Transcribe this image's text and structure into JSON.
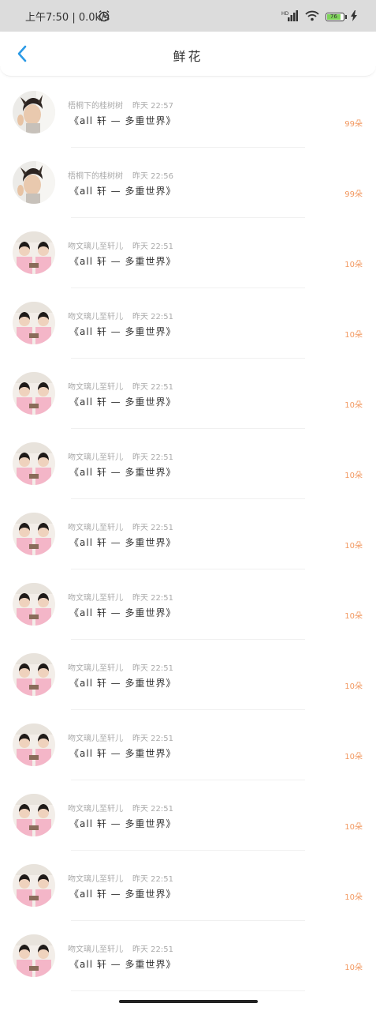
{
  "status_bar": {
    "time_speed": "上午7:50 | 0.0k/s",
    "signal_label": "HD",
    "battery_level": "76"
  },
  "header": {
    "title": "鲜花"
  },
  "items": [
    {
      "user": "梧桐下的桂树树",
      "time": "昨天 22:57",
      "book": "《all 轩 — 多重世界》",
      "count": "99朵",
      "avatar": "person-a"
    },
    {
      "user": "梧桐下的桂树树",
      "time": "昨天 22:56",
      "book": "《all 轩 — 多重世界》",
      "count": "99朵",
      "avatar": "person-a"
    },
    {
      "user": "吻文璃儿至轩儿",
      "time": "昨天 22:51",
      "book": "《all 轩 — 多重世界》",
      "count": "10朵",
      "avatar": "person-b"
    },
    {
      "user": "吻文璃儿至轩儿",
      "time": "昨天 22:51",
      "book": "《all 轩 — 多重世界》",
      "count": "10朵",
      "avatar": "person-b"
    },
    {
      "user": "吻文璃儿至轩儿",
      "time": "昨天 22:51",
      "book": "《all 轩 — 多重世界》",
      "count": "10朵",
      "avatar": "person-b"
    },
    {
      "user": "吻文璃儿至轩儿",
      "time": "昨天 22:51",
      "book": "《all 轩 — 多重世界》",
      "count": "10朵",
      "avatar": "person-b"
    },
    {
      "user": "吻文璃儿至轩儿",
      "time": "昨天 22:51",
      "book": "《all 轩 — 多重世界》",
      "count": "10朵",
      "avatar": "person-b"
    },
    {
      "user": "吻文璃儿至轩儿",
      "time": "昨天 22:51",
      "book": "《all 轩 — 多重世界》",
      "count": "10朵",
      "avatar": "person-b"
    },
    {
      "user": "吻文璃儿至轩儿",
      "time": "昨天 22:51",
      "book": "《all 轩 — 多重世界》",
      "count": "10朵",
      "avatar": "person-b"
    },
    {
      "user": "吻文璃儿至轩儿",
      "time": "昨天 22:51",
      "book": "《all 轩 — 多重世界》",
      "count": "10朵",
      "avatar": "person-b"
    },
    {
      "user": "吻文璃儿至轩儿",
      "time": "昨天 22:51",
      "book": "《all 轩 — 多重世界》",
      "count": "10朵",
      "avatar": "person-b"
    },
    {
      "user": "吻文璃儿至轩儿",
      "time": "昨天 22:51",
      "book": "《all 轩 — 多重世界》",
      "count": "10朵",
      "avatar": "person-b"
    },
    {
      "user": "吻文璃儿至轩儿",
      "time": "昨天 22:51",
      "book": "《all 轩 — 多重世界》",
      "count": "10朵",
      "avatar": "person-b"
    }
  ],
  "colors": {
    "accent": "#2b9ae6",
    "count": "#f29860",
    "status_bar_bg": "#dcdcdc"
  }
}
